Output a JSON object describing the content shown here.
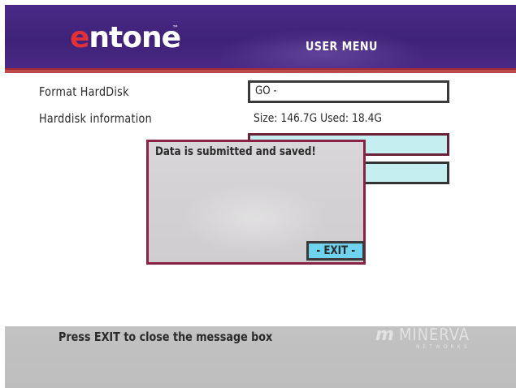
{
  "header": {
    "logo_first": "e",
    "logo_rest": "ntone",
    "logo_tm": "™",
    "title": "USER MENU"
  },
  "rows": {
    "format_label": "Format HardDisk",
    "format_value": "GO -",
    "info_label": "Harddisk information",
    "info_value": "Size: 146.7G Used: 18.4G"
  },
  "modal": {
    "message": "Data is submitted and saved!",
    "exit_label": "- EXIT -"
  },
  "footer": {
    "hint": "Press EXIT to close the message box",
    "brand_mark": "m",
    "brand_name": "MINERVA",
    "brand_sub": "NETWORKS"
  },
  "colors": {
    "header_purple": "#4a2a88",
    "accent_red": "#e0303a",
    "modal_border": "#8a2245",
    "exit_cyan": "#6fd2ee",
    "field_cyan": "#c5eef0",
    "footer_gray": "#c2c2c2"
  }
}
